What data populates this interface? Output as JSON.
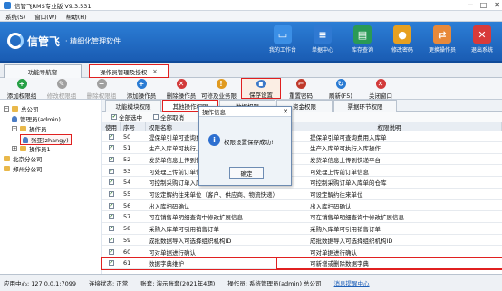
{
  "window": {
    "title": "信管飞RMS专业版 V9.3.531",
    "controls": [
      "─",
      "□",
      "✕"
    ]
  },
  "menu": [
    "系统(S)",
    "窗口(W)",
    "帮助(H)"
  ],
  "brand": {
    "name": "信管飞",
    "tagline": "· 精细化管理软件"
  },
  "topnav": [
    {
      "label": "我的工作台",
      "icon": "desk-icon",
      "color": "#3b8fe6"
    },
    {
      "label": "单据中心",
      "icon": "doc-icon",
      "color": "#2f79d2"
    },
    {
      "label": "库存查询",
      "icon": "warehouse-icon",
      "color": "#2a9a56"
    },
    {
      "label": "修改密码",
      "icon": "lock-icon",
      "color": "#e7a020"
    },
    {
      "label": "更换操作员",
      "icon": "user-swap-icon",
      "color": "#e8893a"
    },
    {
      "label": "退出系统",
      "icon": "exit-icon",
      "color": "#d83a3a"
    }
  ],
  "doc_tabs": [
    {
      "label": "功能导航窗"
    },
    {
      "label": "操作员管理及授权",
      "close": "✕"
    }
  ],
  "toolbar": [
    {
      "label": "添加权限组",
      "icon": "plus-icon",
      "color": "#27a046",
      "enabled": true
    },
    {
      "label": "修改权限组",
      "icon": "edit-icon",
      "color": "#a0a0a0",
      "enabled": false
    },
    {
      "label": "删除权限组",
      "icon": "delete-icon",
      "color": "#a0a0a0",
      "enabled": false
    },
    {
      "label": "添加操作员",
      "icon": "add-user-icon",
      "color": "#2a7bd3",
      "enabled": true
    },
    {
      "label": "删除操作员",
      "icon": "remove-user-icon",
      "color": "#d23a3a",
      "enabled": true
    },
    {
      "label": "可修及业务限制",
      "icon": "restrict-icon",
      "color": "#e09a20",
      "enabled": true
    },
    {
      "label": "保存设置",
      "icon": "save-icon",
      "color": "#3c78c8",
      "enabled": true
    },
    {
      "label": "重置密码",
      "icon": "key-icon",
      "color": "#c0392b",
      "enabled": true
    },
    {
      "label": "刷新(F5)",
      "icon": "refresh-icon",
      "color": "#2a7bd3",
      "enabled": true
    },
    {
      "label": "关闭窗口",
      "icon": "close-window-icon",
      "color": "#d23a3a",
      "enabled": true
    }
  ],
  "tree": [
    {
      "label": "总公司",
      "level": 0,
      "toggle": "−",
      "icon": "folder"
    },
    {
      "label": "管理员(admin)",
      "level": 1,
      "icon": "person"
    },
    {
      "label": "操作员",
      "level": 1,
      "toggle": "−",
      "icon": "folder"
    },
    {
      "label": "张亚(zhangy)",
      "level": 2,
      "icon": "person",
      "selected": true
    },
    {
      "label": "操作员1",
      "level": 1,
      "toggle": "+",
      "icon": "folder"
    },
    {
      "label": "北京分公司",
      "level": 0,
      "icon": "folder"
    },
    {
      "label": "郑州分公司",
      "level": 0,
      "icon": "folder"
    }
  ],
  "subtabs": [
    "功能模块权限",
    "其他操作权限",
    "数据权限",
    "资金权限",
    "票据环节权限"
  ],
  "select": {
    "all": "全部选中",
    "none": "全部取消"
  },
  "columns": [
    "使用",
    "序号",
    "权限名称",
    "权限说明"
  ],
  "rows": [
    {
      "checked": true,
      "no": "50",
      "name": "提保单引单可查询费用入库单",
      "desc": "提保单引单可查询费用入库单"
    },
    {
      "checked": true,
      "no": "51",
      "name": "生产入库单可执行入库操作",
      "desc": "生产入库单可执行入库操作"
    },
    {
      "checked": true,
      "no": "52",
      "name": "发货单信息上传到快递平台",
      "desc": "发货单信息上传到快递平台"
    },
    {
      "checked": true,
      "no": "53",
      "name": "可处理上传前订单信息",
      "desc": "可处理上传前订单信息"
    },
    {
      "checked": true,
      "no": "54",
      "name": "可控制采购订单入库单",
      "desc": "可控制采购订单入库单的仓库"
    },
    {
      "checked": true,
      "no": "55",
      "name": "可设定解约往来单位（客户、供应商、物流快递）",
      "desc": "可设定解约往来单位"
    },
    {
      "checked": true,
      "no": "56",
      "name": "出入库扫码确认",
      "desc": "出入库扫码确认"
    },
    {
      "checked": true,
      "no": "57",
      "name": "可在销售单明细查询中修改扩展信息",
      "desc": "可在销售单明细查询中修改扩展信息"
    },
    {
      "checked": true,
      "no": "58",
      "name": "采购入库单可引用销售订单",
      "desc": "采购入库单可引用销售订单"
    },
    {
      "checked": true,
      "no": "59",
      "name": "成批数据导入可选择组织机构ID",
      "desc": "成批数据导入可选择组织机构ID"
    },
    {
      "checked": true,
      "no": "60",
      "name": "可对单据进行确认",
      "desc": "可对单据进行确认"
    },
    {
      "checked": true,
      "no": "61",
      "name": "数据字典维护",
      "desc": "可新增或删除数据字典",
      "highlight": true
    }
  ],
  "dialog": {
    "title": "操作信息",
    "message": "权限设置保存成功!",
    "ok": "确定"
  },
  "status": {
    "server": "应用中心: 127.0.0.1:7099",
    "conn": "连接状态: 正常",
    "account": "账套: 演示账套(2021年4期)",
    "operator": "操作员: 系统管理员(admin) 总公司",
    "message": "消息提醒中心"
  }
}
